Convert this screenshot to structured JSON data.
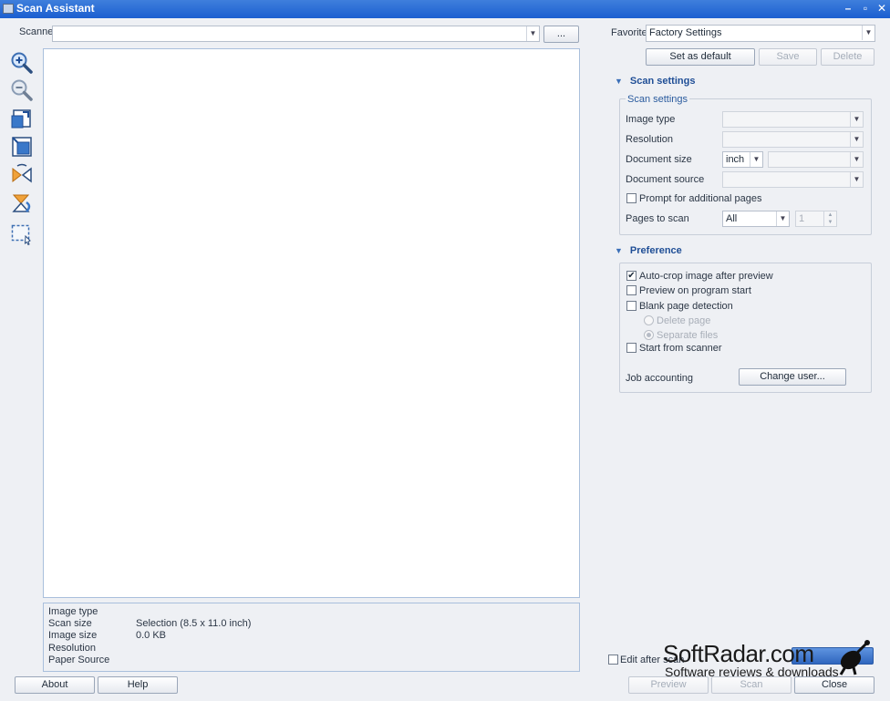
{
  "window": {
    "title": "Scan Assistant",
    "minimize": "–",
    "restore": "▫",
    "close": "✕"
  },
  "scanner": {
    "label": "Scanner",
    "value": "",
    "browse_label": "..."
  },
  "toolbar": {
    "icons": [
      "zoom-in-icon",
      "zoom-out-icon",
      "fit-page-icon",
      "actual-size-icon",
      "flip-icon",
      "rotate-icon",
      "select-area-icon"
    ]
  },
  "info_panel": {
    "image_type_label": "Image type",
    "image_type_value": "",
    "scan_size_label": "Scan size",
    "scan_size_value": "Selection (8.5 x 11.0 inch)",
    "image_size_label": "Image size",
    "image_size_value": "0.0 KB",
    "resolution_label": "Resolution",
    "resolution_value": "",
    "paper_source_label": "Paper Source",
    "paper_source_value": ""
  },
  "favorites": {
    "label": "Favorites",
    "value": "Factory Settings",
    "set_default_label": "Set as default",
    "save_label": "Save",
    "delete_label": "Delete"
  },
  "scan_settings": {
    "section_title": "Scan settings",
    "group_title": "Scan settings",
    "image_type_label": "Image type",
    "resolution_label": "Resolution",
    "document_size_label": "Document size",
    "document_size_unit": "inch",
    "document_source_label": "Document source",
    "prompt_label": "Prompt for additional pages",
    "prompt_checked": false,
    "pages_label": "Pages to scan",
    "pages_value": "All",
    "pages_count": "1"
  },
  "preference": {
    "section_title": "Preference",
    "autocrop_label": "Auto-crop image after preview",
    "autocrop_checked": true,
    "preview_start_label": "Preview on program start",
    "preview_start_checked": false,
    "blank_page_label": "Blank page detection",
    "blank_page_checked": false,
    "delete_page_label": "Delete page",
    "separate_files_label": "Separate files",
    "start_scanner_label": "Start from scanner",
    "start_scanner_checked": false,
    "job_accounting_label": "Job accounting",
    "change_user_label": "Change user..."
  },
  "bottom": {
    "about_label": "About",
    "help_label": "Help",
    "edit_after_scan_label": "Edit after scan",
    "preview_label": "Preview",
    "scan_label": "Scan",
    "close_label": "Close"
  },
  "watermark": {
    "title": "SoftRadar.com",
    "subtitle": "Software reviews & downloads"
  },
  "colors": {
    "titlebar": "#1b5fd0",
    "accent": "#1f4e96",
    "background": "#eef0f4"
  }
}
